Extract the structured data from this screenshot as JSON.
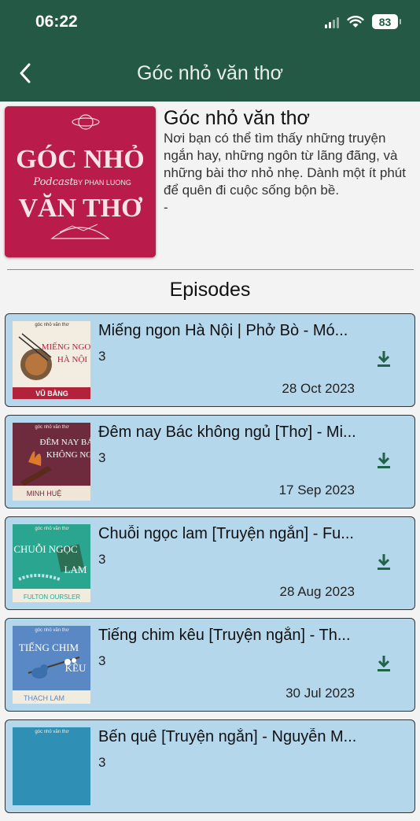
{
  "status": {
    "time": "06:22",
    "battery": "83"
  },
  "header": {
    "title": "Góc nhỏ văn thơ"
  },
  "podcast": {
    "name": "Góc nhỏ văn thơ",
    "description": "Nơi bạn có thể tìm thấy những truyện ngắn hay, những ngôn từ lãng đãng, và những bài thơ nhỏ nhẹ. Dành một ít phút để quên đi cuộc sống bộn bề.",
    "description_dash": "-",
    "cover": {
      "line1": "GÓC NHỎ",
      "podcast_word": "Podcast",
      "by": "BY PHAN LUONG",
      "line2": "VĂN THƠ",
      "bg_color": "#b91c4a"
    }
  },
  "episodes_heading": "Episodes",
  "episodes": [
    {
      "title": "Miếng ngon Hà Nội | Phở Bò - Mó...",
      "number": "3",
      "date": "28 Oct 2023",
      "art_title": "MIẾNG NGON HÀ NỘI",
      "art_author": "VŨ BẰNG",
      "art_brand": "góc nhỏ văn thơ",
      "art_bg": "#f3ede1",
      "art_band": "#b2223b"
    },
    {
      "title": "Đêm nay Bác không ngủ [Thơ] - Mi...",
      "number": "3",
      "date": "17 Sep 2023",
      "art_title": "ĐÊM NAY BÁC KHÔNG NGỦ",
      "art_author": "MINH HUỆ",
      "art_brand": "góc nhỏ văn thơ",
      "art_bg": "#6e2b3d",
      "art_band": "#efe6d8"
    },
    {
      "title": "Chuỗi ngọc lam [Truyện ngắn] - Fu...",
      "number": "3",
      "date": "28 Aug 2023",
      "art_title": "CHUỖI NGỌC LAM",
      "art_author": "FULTON OURSLER",
      "art_brand": "góc nhỏ văn thơ",
      "art_bg": "#2aa58f",
      "art_band": "#f1ece0"
    },
    {
      "title": "Tiếng chim kêu [Truyện ngắn] - Th...",
      "number": "3",
      "date": "30 Jul 2023",
      "art_title": "TIẾNG CHIM KÊU",
      "art_author": "THẠCH LAM",
      "art_brand": "góc nhỏ văn thơ",
      "art_bg": "#5a88c4",
      "art_band": "#f1ece0"
    },
    {
      "title": "Bến quê [Truyện ngắn] - Nguyễn M...",
      "number": "3",
      "date": "",
      "art_title": "",
      "art_author": "",
      "art_brand": "góc nhỏ văn thơ",
      "art_bg": "#2f8fb5",
      "art_band": "#f1ece0"
    }
  ]
}
